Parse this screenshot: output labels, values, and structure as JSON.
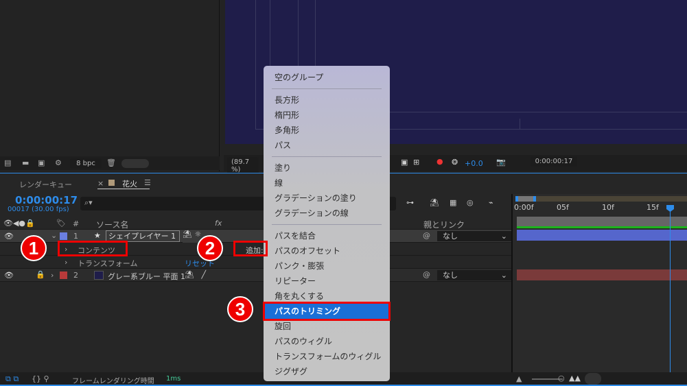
{
  "project_panel": {
    "bpc": "8 bpc"
  },
  "viewer": {
    "zoom": "(89.7 %)",
    "exposure": "+0.0",
    "timecode": "0:00:00:17"
  },
  "timeline": {
    "tabs": [
      {
        "label": "レンダーキュー"
      },
      {
        "label": "花火"
      }
    ],
    "current_time": "0:00:00:17",
    "frame_info": "00017 (30.00 fps)",
    "search_placeholder": "⌕▾",
    "columns": {
      "num": "#",
      "source": "ソース名",
      "parent": "親とリンク",
      "fx": "fx"
    },
    "layers": [
      {
        "num": "1",
        "name": "シェイプレイヤー 1",
        "color": "#6b7fe0",
        "parent": "なし",
        "contents": "コンテンツ",
        "add": "追加:",
        "transform": "トランスフォーム",
        "reset": "リセット"
      },
      {
        "num": "2",
        "name": "グレー系ブルー 平面 1",
        "color": "#b83a3a",
        "parent": "なし"
      }
    ],
    "ruler": [
      "0:00f",
      "05f",
      "10f",
      "15f"
    ]
  },
  "status": {
    "label": "フレームレンダリング時間",
    "value": "1ms"
  },
  "menu": {
    "items": [
      "空のグループ",
      "長方形",
      "楕円形",
      "多角形",
      "パス",
      "塗り",
      "線",
      "グラデーションの塗り",
      "グラデーションの線",
      "パスを結合",
      "パスのオフセット",
      "パンク・膨張",
      "リピーター",
      "角を丸くする",
      "パスのトリミング",
      "旋回",
      "パスのウィグル",
      "トランスフォームのウィグル",
      "ジグザグ"
    ],
    "selected": "パスのトリミング"
  },
  "callouts": [
    "1",
    "2",
    "3"
  ]
}
